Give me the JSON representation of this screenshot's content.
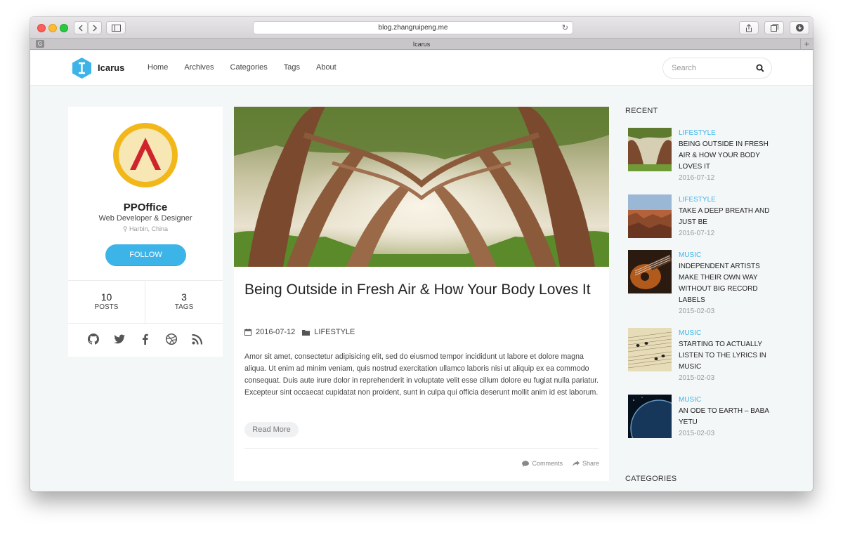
{
  "browser": {
    "url": "blog.zhangruipeng.me",
    "tab_title": "Icarus",
    "tab_favicon": "G",
    "new_tab_label": "+"
  },
  "site": {
    "logo_text": "Icarus",
    "nav": [
      "Home",
      "Archives",
      "Categories",
      "Tags",
      "About"
    ],
    "search_placeholder": "Search"
  },
  "profile": {
    "name": "PPOffice",
    "role": "Web Developer & Designer",
    "location": "Harbin, China",
    "follow_label": "FOLLOW",
    "stats": [
      {
        "value": "10",
        "label": "POSTS"
      },
      {
        "value": "3",
        "label": "TAGS"
      }
    ],
    "socials": [
      "github-icon",
      "twitter-icon",
      "facebook-icon",
      "dribbble-icon",
      "rss-icon"
    ]
  },
  "article": {
    "title": "Being Outside in Fresh Air & How Your Body Loves It",
    "date": "2016-07-12",
    "category": "LIFESTYLE",
    "body": "Amor sit amet, consectetur adipisicing elit, sed do eiusmod tempor incididunt ut labore et dolore magna aliqua. Ut enim ad minim veniam, quis nostrud exercitation ullamco laboris nisi ut aliquip ex ea commodo consequat. Duis aute irure dolor in reprehenderit in voluptate velit esse cillum dolore eu fugiat nulla pariatur. Excepteur sint occaecat cupidatat non proident, sunt in culpa qui officia deserunt mollit anim id est laborum.",
    "read_more": "Read More",
    "comments_label": "Comments",
    "share_label": "Share"
  },
  "sidebar": {
    "recent_heading": "RECENT",
    "categories_heading": "CATEGORIES",
    "recent": [
      {
        "category": "LIFESTYLE",
        "title": "BEING OUTSIDE IN FRESH AIR & HOW YOUR BODY LOVES IT",
        "date": "2016-07-12"
      },
      {
        "category": "LIFESTYLE",
        "title": "TAKE A DEEP BREATH AND JUST BE",
        "date": "2016-07-12"
      },
      {
        "category": "MUSIC",
        "title": "INDEPENDENT ARTISTS MAKE THEIR OWN WAY WITHOUT BIG RECORD LABELS",
        "date": "2015-02-03"
      },
      {
        "category": "MUSIC",
        "title": "STARTING TO ACTUALLY LISTEN TO THE LYRICS IN MUSIC",
        "date": "2015-02-03"
      },
      {
        "category": "MUSIC",
        "title": "AN ODE TO EARTH – BABA YETU",
        "date": "2015-02-03"
      }
    ]
  },
  "colors": {
    "accent": "#3db4e8",
    "background": "#f4f7f8"
  }
}
